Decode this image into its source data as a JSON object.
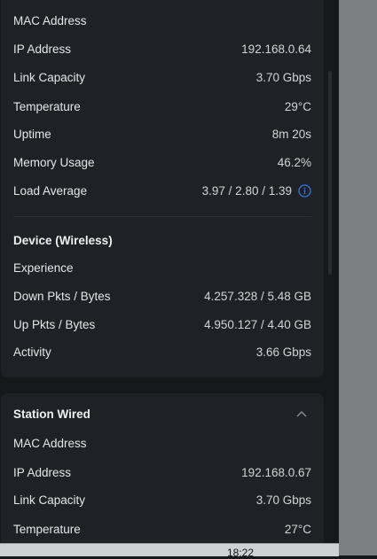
{
  "station_top": {
    "rows": [
      {
        "label": "MAC Address",
        "value": ""
      },
      {
        "label": "IP Address",
        "value": "192.168.0.64"
      },
      {
        "label": "Link Capacity",
        "value": "3.70 Gbps"
      },
      {
        "label": "Temperature",
        "value": "29°C"
      },
      {
        "label": "Uptime",
        "value": "8m 20s"
      },
      {
        "label": "Memory Usage",
        "value": "46.2%"
      },
      {
        "label": "Load Average",
        "value": "3.97 / 2.80 / 1.39"
      }
    ],
    "wireless_title": "Device (Wireless)",
    "wireless_rows": [
      {
        "label": "Experience",
        "value": ""
      },
      {
        "label": "Down Pkts / Bytes",
        "value": "4.257.328 / 5.48 GB"
      },
      {
        "label": "Up Pkts / Bytes",
        "value": "4.950.127 / 4.40 GB"
      },
      {
        "label": "Activity",
        "value": "3.66 Gbps"
      }
    ]
  },
  "station_wired": {
    "title": "Station Wired",
    "rows": [
      {
        "label": "MAC Address",
        "value": ""
      },
      {
        "label": "IP Address",
        "value": "192.168.0.67"
      },
      {
        "label": "Link Capacity",
        "value": "3.70 Gbps"
      },
      {
        "label": "Temperature",
        "value": "27°C"
      }
    ]
  },
  "taskbar": {
    "clock": "18:22"
  },
  "colors": {
    "accent": "#2f7be5",
    "card": "#1f2126",
    "background": "#17181c"
  },
  "icons": {
    "load_info": "info-circle-icon",
    "collapse": "chevron-up-icon"
  }
}
